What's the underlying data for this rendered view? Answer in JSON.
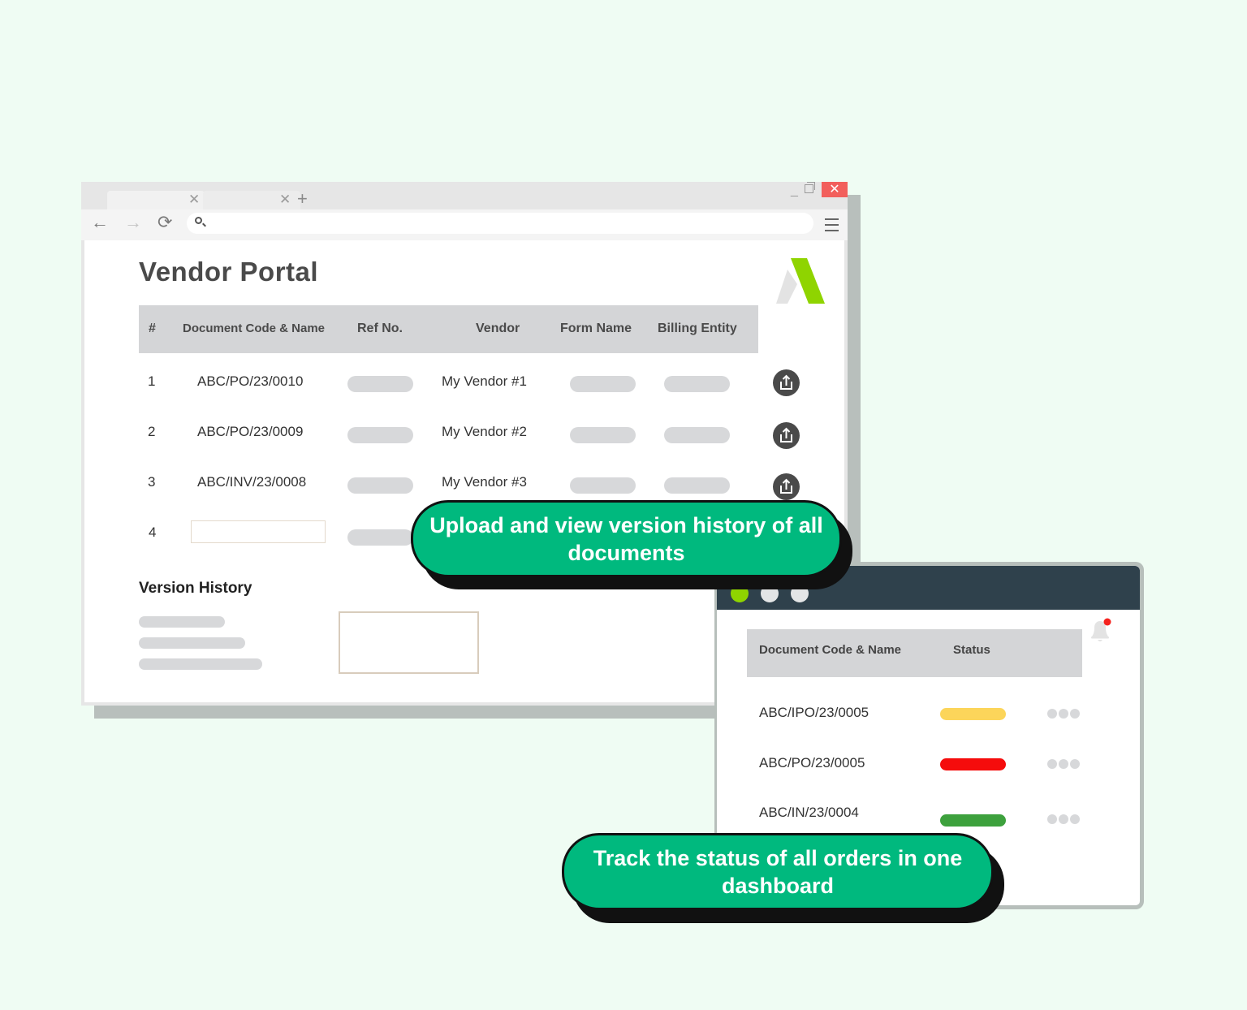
{
  "browser": {
    "window_controls": {
      "minimize": "_",
      "close": "✕"
    },
    "tabs": [
      {
        "close": "✕"
      },
      {
        "close": "✕"
      }
    ],
    "new_tab": "+",
    "nav": {
      "back": "←",
      "forward": "→",
      "reload": "⟳"
    }
  },
  "portal": {
    "title": "Vendor Portal",
    "brand_colors": {
      "accent": "#8fd400",
      "gray": "#e3e3e3"
    },
    "columns": [
      "#",
      "Document Code & Name",
      "Ref No.",
      "Vendor",
      "Form Name",
      "Billing Entity"
    ],
    "rows": [
      {
        "num": "1",
        "code": "ABC/PO/23/0010",
        "vendor": "My Vendor #1"
      },
      {
        "num": "2",
        "code": "ABC/PO/23/0009",
        "vendor": "My Vendor #2"
      },
      {
        "num": "3",
        "code": "ABC/INV/23/0008",
        "vendor": "My Vendor #3"
      },
      {
        "num": "4",
        "code": "",
        "vendor": ""
      }
    ],
    "version_history": {
      "title": "Version History"
    }
  },
  "dashboard": {
    "traffic_colors": [
      "#8fd400",
      "#e3e5e6",
      "#e3e5e6"
    ],
    "columns": [
      "Document Code & Name",
      "Status"
    ],
    "rows": [
      {
        "code": "ABC/IPO/23/0005",
        "status_color": "#fcd55a"
      },
      {
        "code": "ABC/PO/23/0005",
        "status_color": "#f50c0c"
      },
      {
        "code": "ABC/IN/23/0004",
        "status_color": "#3da13d"
      }
    ],
    "notification_color": "#f5231f"
  },
  "callouts": {
    "upload": "Upload and view version history of all documents",
    "track": "Track the status of all orders in one dashboard"
  }
}
